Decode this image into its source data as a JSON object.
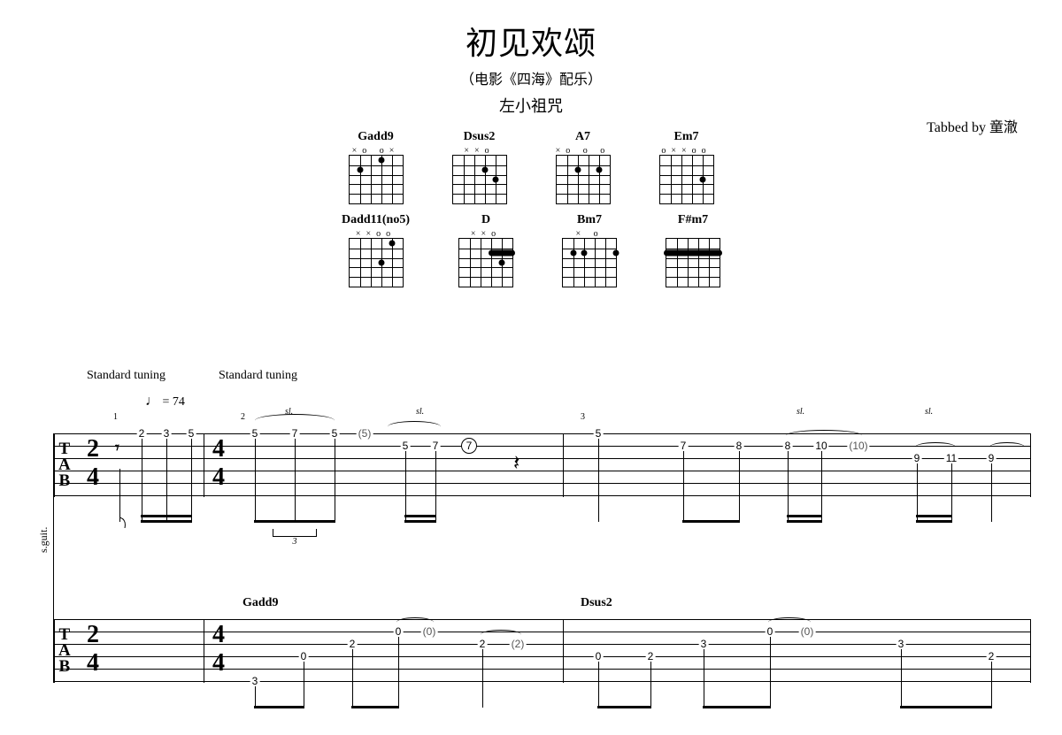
{
  "title": "初见欢颂",
  "subtitle": "（电影《四海》配乐）",
  "composer": "左小祖咒",
  "tabbed_by": "Tabbed by 童澈",
  "tunings": [
    "Standard tuning",
    "Standard tuning"
  ],
  "tempo_symbol": "♩",
  "tempo_eq": " = ",
  "tempo_value": "74",
  "instrument_label": "s.guit.",
  "chords": {
    "row1": [
      {
        "name": "Gadd9",
        "hdr": "  ×o  o×"
      },
      {
        "name": "Dsus2",
        "hdr": "××o       "
      },
      {
        "name": "A7",
        "hdr": "×o   o o"
      },
      {
        "name": "Em7",
        "hdr": "o××oo  "
      }
    ],
    "row2": [
      {
        "name": "Dadd11(no5)",
        "hdr": "××oo    "
      },
      {
        "name": "D",
        "hdr": "××o      "
      },
      {
        "name": "Bm7",
        "hdr": "×   o   "
      },
      {
        "name": "F#m7",
        "hdr": "          "
      }
    ]
  },
  "tab1": {
    "ts1": {
      "num": "2",
      "den": "4"
    },
    "ts2": {
      "num": "4",
      "den": "4"
    },
    "barnums": [
      "1",
      "2",
      "3"
    ],
    "notes": {
      "m1": [
        "2",
        "3",
        "5"
      ],
      "m2": [
        "5",
        "7",
        "5",
        "(5)",
        "5",
        "7",
        "7"
      ],
      "m3a": [
        "5",
        "7",
        "8",
        "8",
        "10",
        "(10)"
      ],
      "m3b": [
        "9",
        "11",
        "9"
      ]
    },
    "sl": "sl."
  },
  "tab2": {
    "ts1": {
      "num": "2",
      "den": "4"
    },
    "ts2": {
      "num": "4",
      "den": "4"
    },
    "chord_m2": "Gadd9",
    "chord_m3": "Dsus2",
    "m2": [
      "3",
      "0",
      "2",
      "0",
      "(0)",
      "2",
      "(2)"
    ],
    "m3": [
      "0",
      "2",
      "3",
      "0",
      "(0)",
      "3",
      "2"
    ]
  },
  "triplet_label": "3",
  "rest": "𝄽"
}
